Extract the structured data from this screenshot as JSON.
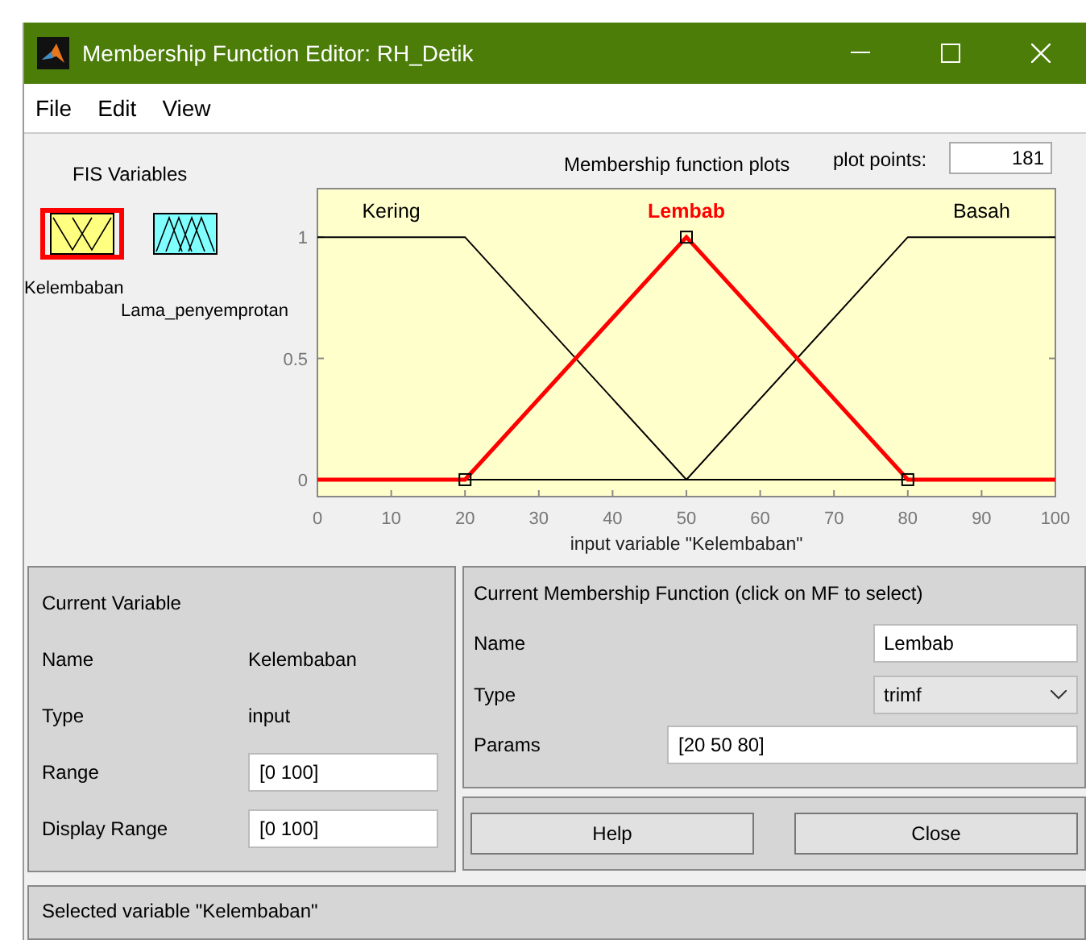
{
  "window": {
    "title": "Membership Function Editor: RH_Detik"
  },
  "menu": [
    "File",
    "Edit",
    "View"
  ],
  "fis_variables": {
    "title": "FIS Variables",
    "items": [
      {
        "label": "Kelembaban",
        "kind": "input",
        "selected": true
      },
      {
        "label": "Lama_penyemprotan",
        "kind": "output",
        "selected": false
      }
    ]
  },
  "plot": {
    "title": "Membership function plots",
    "plot_points_label": "plot points:",
    "plot_points": "181",
    "chart_data": {
      "type": "line",
      "xlabel": "input variable \"Kelembaban\"",
      "x": [
        0,
        20,
        50,
        80,
        100
      ],
      "xlim": [
        0,
        100
      ],
      "ylim": [
        -0.07,
        1.2
      ],
      "xticks": [
        0,
        10,
        20,
        30,
        40,
        50,
        60,
        70,
        80,
        90,
        100
      ],
      "yticks": [
        0,
        0.5,
        1
      ],
      "series": [
        {
          "name": "Kering",
          "color": "#000000",
          "values": [
            1,
            1,
            0,
            0,
            0
          ]
        },
        {
          "name": "Lembab",
          "color": "#ff0000",
          "values": [
            0,
            0,
            1,
            0,
            0
          ]
        },
        {
          "name": "Basah",
          "color": "#000000",
          "values": [
            0,
            0,
            0,
            1,
            1
          ]
        }
      ]
    }
  },
  "current_variable": {
    "title": "Current Variable",
    "name_label": "Name",
    "name": "Kelembaban",
    "type_label": "Type",
    "type": "input",
    "range_label": "Range",
    "range": "[0 100]",
    "display_range_label": "Display Range",
    "display_range": "[0 100]"
  },
  "current_mf": {
    "title": "Current Membership Function (click on MF to select)",
    "name_label": "Name",
    "name": "Lembab",
    "type_label": "Type",
    "type": "trimf",
    "params_label": "Params",
    "params": "[20 50 80]"
  },
  "buttons": [
    "Help",
    "Close"
  ],
  "status_bar": "Selected variable \"Kelembaban\""
}
